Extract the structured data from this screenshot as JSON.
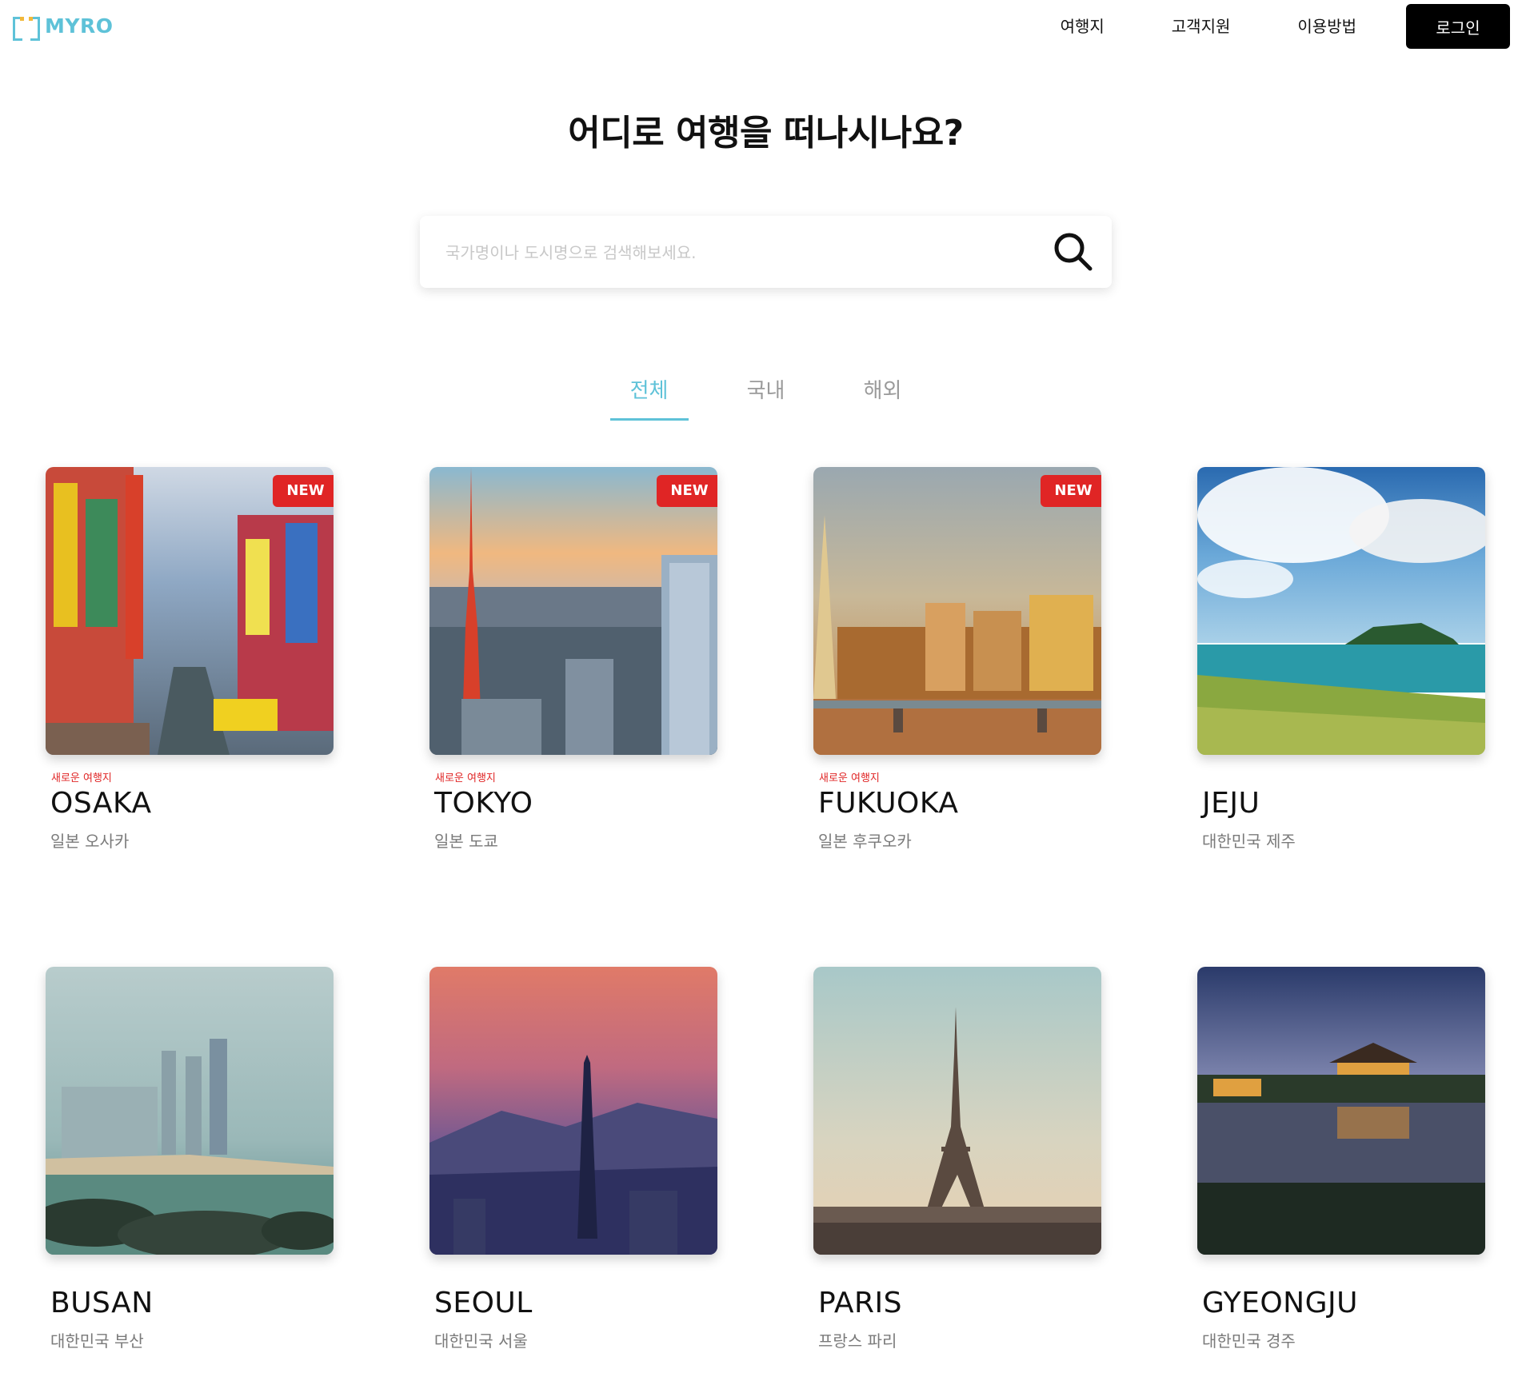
{
  "header": {
    "logo": "MYRO",
    "nav": [
      "여행지",
      "고객지원",
      "이용방법"
    ],
    "login": "로그인"
  },
  "hero": {
    "title": "어디로 여행을 떠나시나요?",
    "search_placeholder": "국가명이나 도시명으로 검색해보세요."
  },
  "tabs": [
    {
      "label": "전체",
      "active": true
    },
    {
      "label": "국내",
      "active": false
    },
    {
      "label": "해외",
      "active": false
    }
  ],
  "cards": [
    {
      "name": "OSAKA",
      "country": "일본 오사카",
      "subtitle": "새로운 여행지",
      "badge": "NEW",
      "icon": "osaka-photo"
    },
    {
      "name": "TOKYO",
      "country": "일본 도쿄",
      "subtitle": "새로운 여행지",
      "badge": "NEW",
      "icon": "tokyo-photo"
    },
    {
      "name": "FUKUOKA",
      "country": "일본 후쿠오카",
      "subtitle": "새로운 여행지",
      "badge": "NEW",
      "icon": "fukuoka-photo"
    },
    {
      "name": "JEJU",
      "country": "대한민국 제주",
      "subtitle": "",
      "badge": "",
      "icon": "jeju-photo"
    },
    {
      "name": "BUSAN",
      "country": "대한민국 부산",
      "subtitle": "",
      "badge": "",
      "icon": "busan-photo"
    },
    {
      "name": "SEOUL",
      "country": "대한민국 서울",
      "subtitle": "",
      "badge": "",
      "icon": "seoul-photo"
    },
    {
      "name": "PARIS",
      "country": "프랑스 파리",
      "subtitle": "",
      "badge": "",
      "icon": "paris-photo"
    },
    {
      "name": "GYEONGJU",
      "country": "대한민국 경주",
      "subtitle": "",
      "badge": "",
      "icon": "gyeongju-photo"
    }
  ],
  "colors": {
    "accent": "#5ec2d8",
    "new_badge": "#e02525",
    "login_bg": "#000000"
  }
}
